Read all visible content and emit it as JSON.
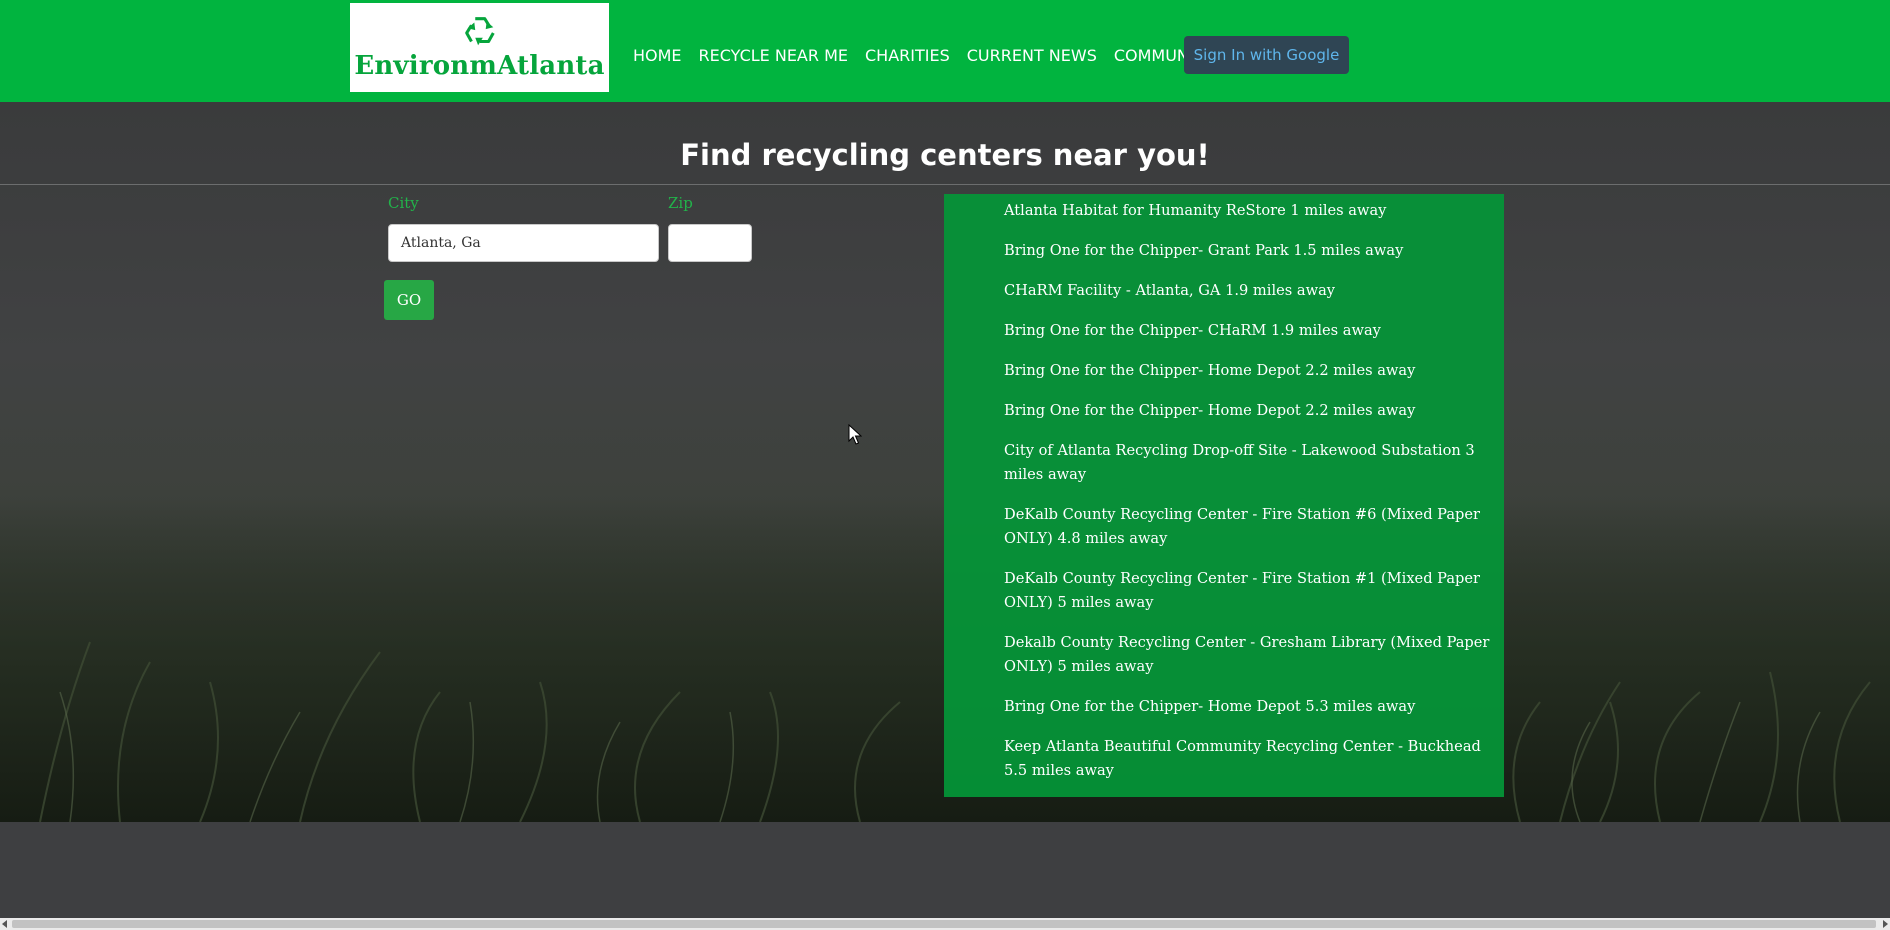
{
  "header": {
    "logo_text": "EnvironmAtlanta",
    "logo_icon": "recycle-icon",
    "nav": [
      {
        "label": "HOME"
      },
      {
        "label": "RECYCLE NEAR ME"
      },
      {
        "label": "CHARITIES"
      },
      {
        "label": "CURRENT NEWS"
      },
      {
        "label": "COMMUNITY"
      }
    ],
    "signin_label": "Sign In with Google"
  },
  "colors": {
    "header_green": "#01b43f",
    "results_green": "#049638",
    "go_button": "#27a745",
    "signin_bg": "#2f4554",
    "signin_text": "#5fb6ec"
  },
  "hero": {
    "title": "Find recycling centers near you!"
  },
  "form": {
    "city_label": "City",
    "city_value": "Atlanta, Ga",
    "zip_label": "Zip",
    "zip_value": "",
    "go_label": "GO"
  },
  "results": [
    "Atlanta Habitat for Humanity ReStore 1 miles away",
    "Bring One for the Chipper- Grant Park 1.5 miles away",
    "CHaRM Facility - Atlanta, GA 1.9 miles away",
    "Bring One for the Chipper- CHaRM 1.9 miles away",
    "Bring One for the Chipper- Home Depot 2.2 miles away",
    "Bring One for the Chipper- Home Depot 2.2 miles away",
    "City of Atlanta Recycling Drop-off Site - Lakewood Substation 3 miles away",
    "DeKalb County Recycling Center - Fire Station #6 (Mixed Paper ONLY) 4.8 miles away",
    "DeKalb County Recycling Center - Fire Station #1 (Mixed Paper ONLY) 5 miles away",
    "Dekalb County Recycling Center - Gresham Library (Mixed Paper ONLY) 5 miles away",
    "Bring One for the Chipper- Home Depot 5.3 miles away",
    "Keep Atlanta Beautiful Community Recycling Center - Buckhead 5.5 miles away"
  ]
}
